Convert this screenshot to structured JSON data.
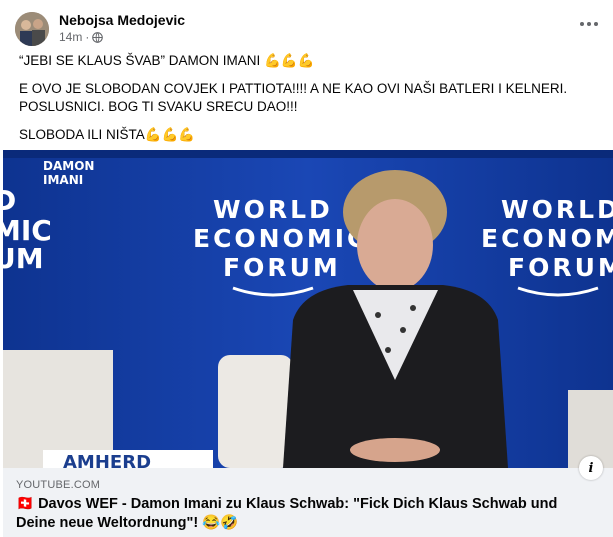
{
  "post": {
    "author": "Nebojsa Medojevic",
    "time": "14m",
    "separator": "·",
    "more_label": "•••",
    "line1": "“JEBI SE KLAUS ŠVAB” DAMON IMANI 💪💪💪",
    "line2": "E OVO JE SLOBODAN COVJEK I PATTIOTA!!!! A NE KAO OVI NAŠI BATLERI I KELNERI. POSLUSNICI. BOG TI SVAKU SRECU DAO!!!",
    "line3": "SLOBODA ILI NIŠTA💪💪💪"
  },
  "video": {
    "caption_left": "DAMON",
    "caption_left2": "IMANI",
    "logo_line1": "WORLD",
    "logo_line2": "ECONOMIC",
    "logo_line3": "FORUM",
    "nameplate": "AMHERD"
  },
  "link": {
    "domain": "YOUTUBE.COM",
    "title": "🇨🇭 Davos WEF - Damon Imani zu Klaus Schwab: \"Fick Dich Klaus Schwab und Deine neue Weltordnung\"! 😂🤣",
    "info_label": "i"
  },
  "colors": {
    "stage_blue": "#123a9e",
    "meta_gray": "#65676b",
    "link_bg": "#f0f2f5"
  }
}
